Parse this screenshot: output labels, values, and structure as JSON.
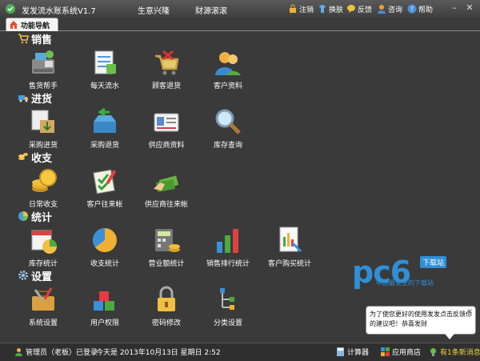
{
  "titlebar": {
    "title": "发发流水账系统V1.7",
    "slogan1": "生意兴隆",
    "slogan2": "财源滚滚",
    "menu": {
      "logout": "注销",
      "skin": "换肤",
      "feedback": "反馈",
      "consult": "咨询",
      "help": "帮助"
    }
  },
  "tab": {
    "label": "功能导航"
  },
  "sections": {
    "sales": {
      "title": "销售",
      "items": [
        "售货帮手",
        "每天流水",
        "顾客退货",
        "客户资料"
      ]
    },
    "purchase": {
      "title": "进货",
      "items": [
        "采购进货",
        "采购退货",
        "供应商资料",
        "库存查询"
      ]
    },
    "finance": {
      "title": "收支",
      "items": [
        "日常收支",
        "客户往来帐",
        "供应商往来帐"
      ]
    },
    "stats": {
      "title": "统计",
      "items": [
        "库存统计",
        "收支统计",
        "营业额统计",
        "销售排行统计",
        "客户购买统计"
      ]
    },
    "settings": {
      "title": "设置",
      "items": [
        "系统设置",
        "用户权限",
        "密码修改",
        "分类设置"
      ]
    }
  },
  "watermark": {
    "text": "pc6",
    "badge": "下载站",
    "sub": "中国最安全的下载站"
  },
  "tip": {
    "text": "为了使您更好的使用发发点击反馈你的建议吧！恭喜发财"
  },
  "status": {
    "user": "管理员（老板）已登录",
    "date": "今天是  2013年10月13日  星期日  2:52",
    "calculator": "计算器",
    "appstore": "应用商店",
    "messages": "有1条新消息"
  },
  "colors": {
    "background": "#3a3a3a",
    "accent": "#2f8fd6"
  }
}
